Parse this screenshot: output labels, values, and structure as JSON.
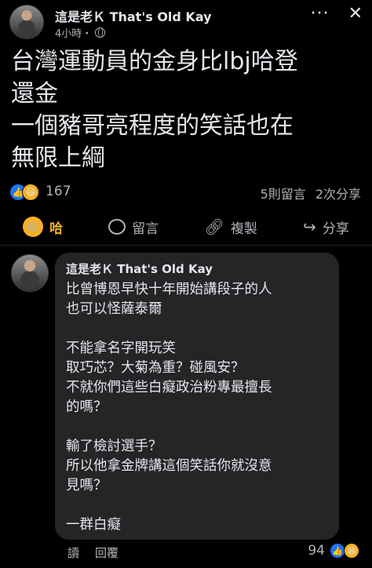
{
  "post": {
    "author": "這是老Ｋ That's Old Kay",
    "time": "4小時・",
    "text_lines": [
      "台灣運動員的金身比lbj哈登",
      "還金",
      "一個豬哥亮程度的笑話也在",
      "無限上綱"
    ],
    "reaction_count": "167",
    "comments_count": "5則留言",
    "shares_count": "2次分享"
  },
  "actions": {
    "haha_label": "哈",
    "comment_label": "留言",
    "copy_label": "複製",
    "share_label": "分享"
  },
  "comment": {
    "author": "這是老Ｋ That's Old Kay",
    "lines": [
      "比曾博恩早快十年開始講段子的人",
      "也可以怪薩泰爾",
      "",
      "不能拿名字開玩笑",
      "取巧芯？大菊為重？碰風安？",
      "不就你們這些白癡政治粉專最擅長",
      "的嗎？",
      "",
      "輸了檢討選手？",
      "所以他拿金牌講這個笑話你就沒意",
      "見嗎？",
      "",
      "一群白癡"
    ],
    "read_label": "讀",
    "reply_label": "回覆",
    "reaction_count": "94"
  },
  "icons": {
    "more": "more-icon",
    "close": "close-icon",
    "globe": "globe-icon",
    "like": "like-icon",
    "haha": "haha-icon",
    "comment": "comment-icon",
    "copy": "copy-icon",
    "share": "share-icon"
  },
  "colors": {
    "background": "#000000",
    "bubble": "#242526",
    "like_blue": "#1877f2",
    "haha_yellow": "#f7b125",
    "secondary_text": "#b0b3b8"
  }
}
